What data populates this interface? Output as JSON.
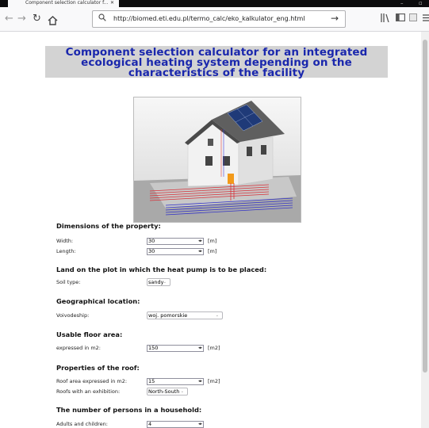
{
  "browser": {
    "tab_title": "Component selection calculator f...",
    "tab_close": "✕",
    "url": "http://biomed.eti.edu.pl/termo_calc/eko_kalkulator_eng.html"
  },
  "page": {
    "title": "Component selection calculator for an integrated ecological heating system depending on the characteristics of the facility",
    "sections": {
      "dimensions": "Dimensions of the property:",
      "land": "Land on the plot in which the heat pump is to be placed:",
      "location": "Geographical location:",
      "floor": "Usable floor area:",
      "roof": "Properties of the roof:",
      "persons": "The number of persons in a household:"
    },
    "fields": {
      "width": {
        "label": "Width:",
        "value": "30",
        "unit": "[m]"
      },
      "length": {
        "label": "Length:",
        "value": "30",
        "unit": "[m]"
      },
      "soil": {
        "label": "Soil type:",
        "value": "sandy"
      },
      "voivodeship": {
        "label": "Voivodeship:",
        "value": "woj. pomorskie"
      },
      "floor_area": {
        "label": "expressed in m2:",
        "value": "150",
        "unit": "[m2]"
      },
      "roof_area": {
        "label": "Roof area expressed in m2:",
        "value": "15",
        "unit": "[m2]"
      },
      "roof_exposure": {
        "label": "Roofs with an exhibition:",
        "value": "North-South"
      },
      "persons": {
        "label": "Adults and children:",
        "value": "4"
      }
    }
  }
}
